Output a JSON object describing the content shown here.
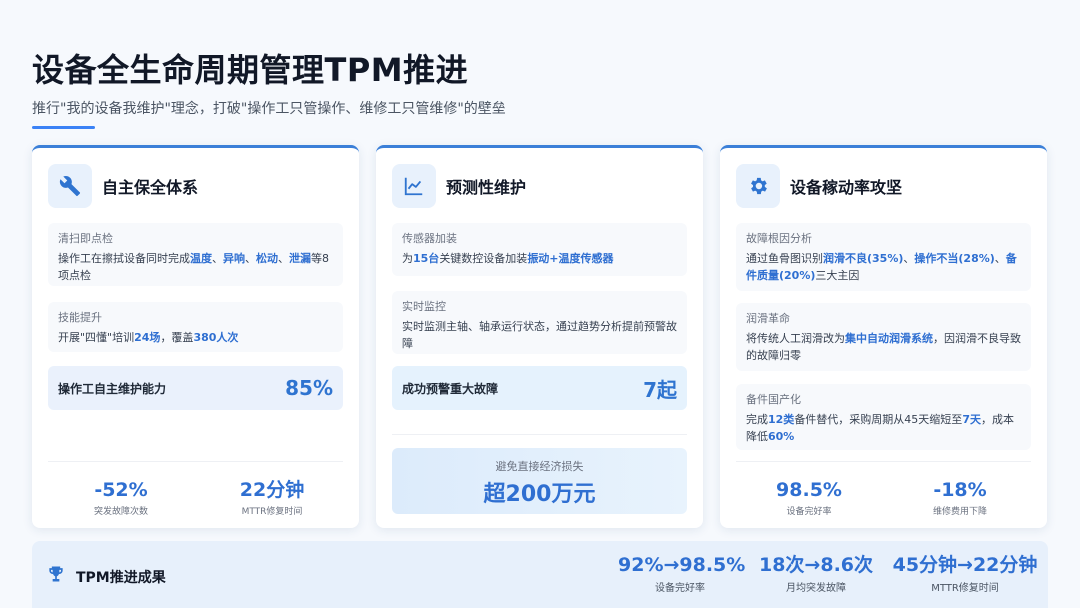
{
  "header": {
    "title": "设备全生命周期管理TPM推进",
    "subtitle": "推行\"我的设备我维护\"理念，打破\"操作工只管操作、维修工只管维修\"的壁垒"
  },
  "colors": {
    "accent": "#2f6fd1",
    "card_border": "#3b7fd8",
    "icon_bg": "#e8f1fc"
  },
  "cards": [
    {
      "icon": "wrench-icon",
      "title": "自主保全体系",
      "blocks": [
        {
          "label": "清扫即点检",
          "text": [
            "操作工在擦拭设备同时完成",
            "温度",
            "、",
            "异响",
            "、",
            "松动",
            "、",
            "泄漏",
            "等8项点检"
          ]
        },
        {
          "label": "技能提升",
          "text": [
            "开展\"四懂\"培训",
            "24场",
            "，覆盖",
            "380人次"
          ]
        }
      ],
      "metric": {
        "label": "操作工自主维护能力",
        "value": "85%"
      },
      "stats": [
        {
          "value": "-52%",
          "label": "突发故障次数"
        },
        {
          "value": "22分钟",
          "label": "MTTR修复时间"
        }
      ]
    },
    {
      "icon": "line-chart-icon",
      "title": "预测性维护",
      "blocks": [
        {
          "label": "传感器加装",
          "text": [
            "为",
            "15台",
            "关键数控设备加装",
            "振动+温度传感器"
          ]
        },
        {
          "label": "实时监控",
          "text": [
            "实时监测主轴、轴承运行状态，通过趋势分析提前预警故障"
          ]
        }
      ],
      "metric": {
        "label": "成功预警重大故障",
        "value": "7起"
      },
      "loss": {
        "label": "避免直接经济损失",
        "value": "超200万元"
      }
    },
    {
      "icon": "gear-icon",
      "title": "设备稼动率攻坚",
      "blocks": [
        {
          "label": "故障根因分析",
          "text": [
            "通过鱼骨图识别",
            "润滑不良(35%)",
            "、",
            "操作不当(28%)",
            "、",
            "备件质量(20%)",
            "三大主因"
          ]
        },
        {
          "label": "润滑革命",
          "text": [
            "将传统人工润滑改为",
            "集中自动润滑系统",
            "，因润滑不良导致的故障归零"
          ]
        },
        {
          "label": "备件国产化",
          "text": [
            "完成",
            "12类",
            "备件替代，采购周期从45天缩短至",
            "7天",
            "，成本降低",
            "60%"
          ]
        }
      ],
      "stats": [
        {
          "value": "98.5%",
          "label": "设备完好率"
        },
        {
          "value": "-18%",
          "label": "维修费用下降"
        }
      ]
    }
  ],
  "footer": {
    "icon": "trophy-icon",
    "title": "TPM推进成果",
    "stats": [
      {
        "value": "92%→98.5%",
        "label": "设备完好率"
      },
      {
        "value": "18次→8.6次",
        "label": "月均突发故障"
      },
      {
        "value": "45分钟→22分钟",
        "label": "MTTR修复时间"
      }
    ]
  }
}
